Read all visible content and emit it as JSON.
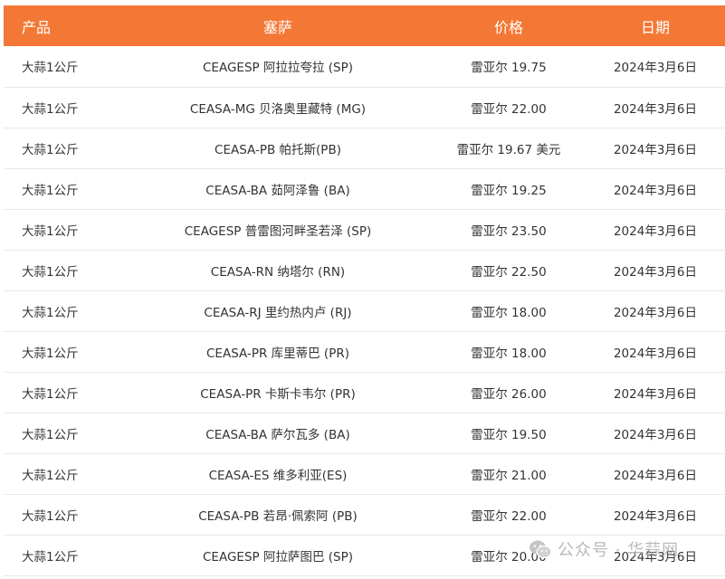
{
  "table": {
    "headers": [
      "产品",
      "塞萨",
      "价格",
      "日期"
    ],
    "rows": [
      {
        "product": "大蒜1公斤",
        "ceasa": "CEAGESP 阿拉拉夸拉 (SP)",
        "price": "雷亚尔 19.75",
        "date": "2024年3月6日"
      },
      {
        "product": "大蒜1公斤",
        "ceasa": "CEASA-MG 贝洛奥里藏特 (MG)",
        "price": "雷亚尔 22.00",
        "date": "2024年3月6日"
      },
      {
        "product": "大蒜1公斤",
        "ceasa": "CEASA-PB 帕托斯(PB)",
        "price": "雷亚尔 19.67 美元",
        "date": "2024年3月6日"
      },
      {
        "product": "大蒜1公斤",
        "ceasa": "CEASA-BA 茹阿泽鲁 (BA)",
        "price": "雷亚尔 19.25",
        "date": "2024年3月6日"
      },
      {
        "product": "大蒜1公斤",
        "ceasa": "CEAGESP 普雷图河畔圣若泽 (SP)",
        "price": "雷亚尔 23.50",
        "date": "2024年3月6日"
      },
      {
        "product": "大蒜1公斤",
        "ceasa": "CEASA-RN 纳塔尔 (RN)",
        "price": "雷亚尔 22.50",
        "date": "2024年3月6日"
      },
      {
        "product": "大蒜1公斤",
        "ceasa": "CEASA-RJ 里约热内卢 (RJ)",
        "price": "雷亚尔 18.00",
        "date": "2024年3月6日"
      },
      {
        "product": "大蒜1公斤",
        "ceasa": "CEASA-PR 库里蒂巴 (PR)",
        "price": "雷亚尔 18.00",
        "date": "2024年3月6日"
      },
      {
        "product": "大蒜1公斤",
        "ceasa": "CEASA-PR 卡斯卡韦尔 (PR)",
        "price": "雷亚尔 26.00",
        "date": "2024年3月6日"
      },
      {
        "product": "大蒜1公斤",
        "ceasa": "CEASA-BA 萨尔瓦多 (BA)",
        "price": "雷亚尔 19.50",
        "date": "2024年3月6日"
      },
      {
        "product": "大蒜1公斤",
        "ceasa": "CEASA-ES 维多利亚(ES)",
        "price": "雷亚尔 21.00",
        "date": "2024年3月6日"
      },
      {
        "product": "大蒜1公斤",
        "ceasa": "CEASA-PB 若昂·佩索阿 (PB)",
        "price": "雷亚尔 22.00",
        "date": "2024年3月6日"
      },
      {
        "product": "大蒜1公斤",
        "ceasa": "CEAGESP 阿拉萨图巴 (SP)",
        "price": "雷亚尔 20.00",
        "date": "2024年3月6日"
      }
    ]
  },
  "watermark": {
    "icon": "wechat-icon",
    "text": "公众号 · 华蒜网"
  },
  "colors": {
    "header_bg": "#f47835",
    "header_text": "#ffffff",
    "row_divider": "#e9e9e9",
    "body_text": "#333333"
  }
}
